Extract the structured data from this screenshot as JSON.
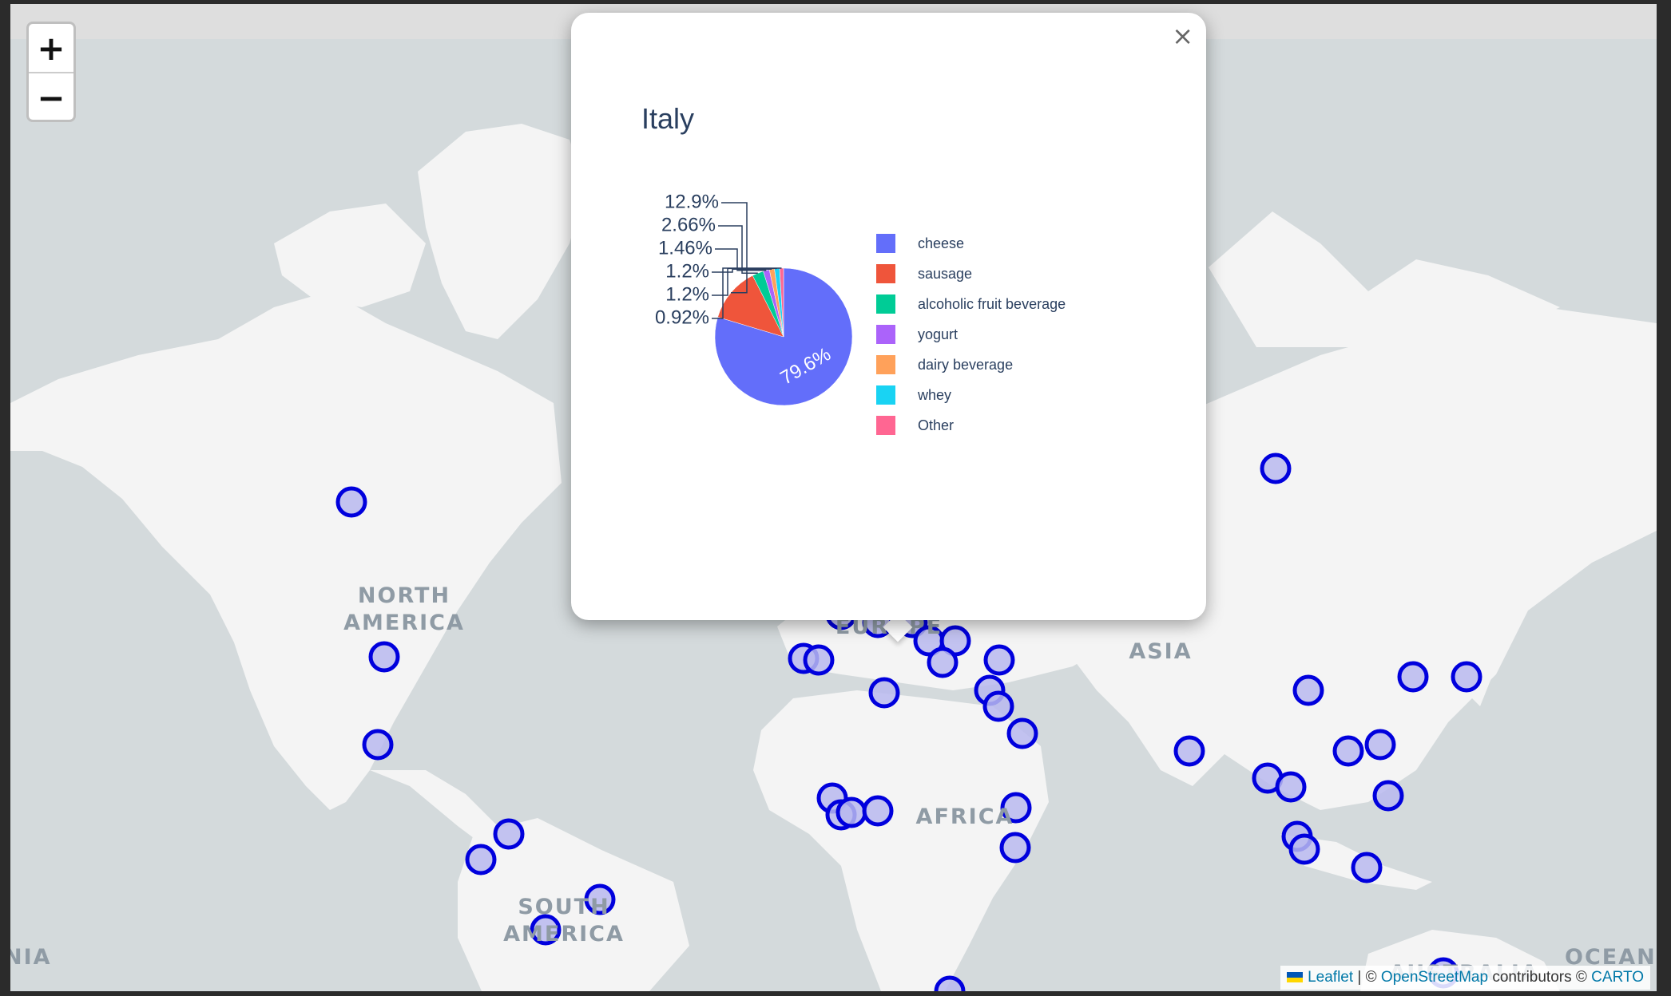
{
  "map": {
    "zoom_in_label": "+",
    "zoom_out_label": "−",
    "region_labels": {
      "north_america_1": "NORTH",
      "north_america_2": "AMERICA",
      "south_america_1": "SOUTH",
      "south_america_2": "AMERICA",
      "europe": "EUROPE",
      "asia": "ASIA",
      "africa": "AFRICA",
      "australia": "AUSTRALIA",
      "oceania": "OCEANI",
      "left_edge": "NIA"
    },
    "marker_count": 46,
    "marker_color": "#0000dd",
    "marker_fill": "#b8b8ee"
  },
  "popup": {
    "close_label": "×",
    "title": "Italy",
    "chart_data": {
      "type": "pie",
      "title": "Italy",
      "labels": [
        "cheese",
        "sausage",
        "alcoholic fruit beverage",
        "yogurt",
        "dairy beverage",
        "whey",
        "Other"
      ],
      "values": [
        79.6,
        12.9,
        2.66,
        1.46,
        1.2,
        1.2,
        0.92
      ],
      "value_labels": [
        "79.6%",
        "12.9%",
        "2.66%",
        "1.46%",
        "1.2%",
        "1.2%",
        "0.92%"
      ],
      "colors": [
        "#636efa",
        "#ef553b",
        "#00cc96",
        "#ab63fa",
        "#ffa15a",
        "#19d3f3",
        "#ff6692"
      ],
      "legend_position": "right"
    }
  },
  "attribution": {
    "leaflet": "Leaflet",
    "sep1": " | © ",
    "osm": "OpenStreetMap",
    "contributors": " contributors © ",
    "carto": "CARTO"
  }
}
